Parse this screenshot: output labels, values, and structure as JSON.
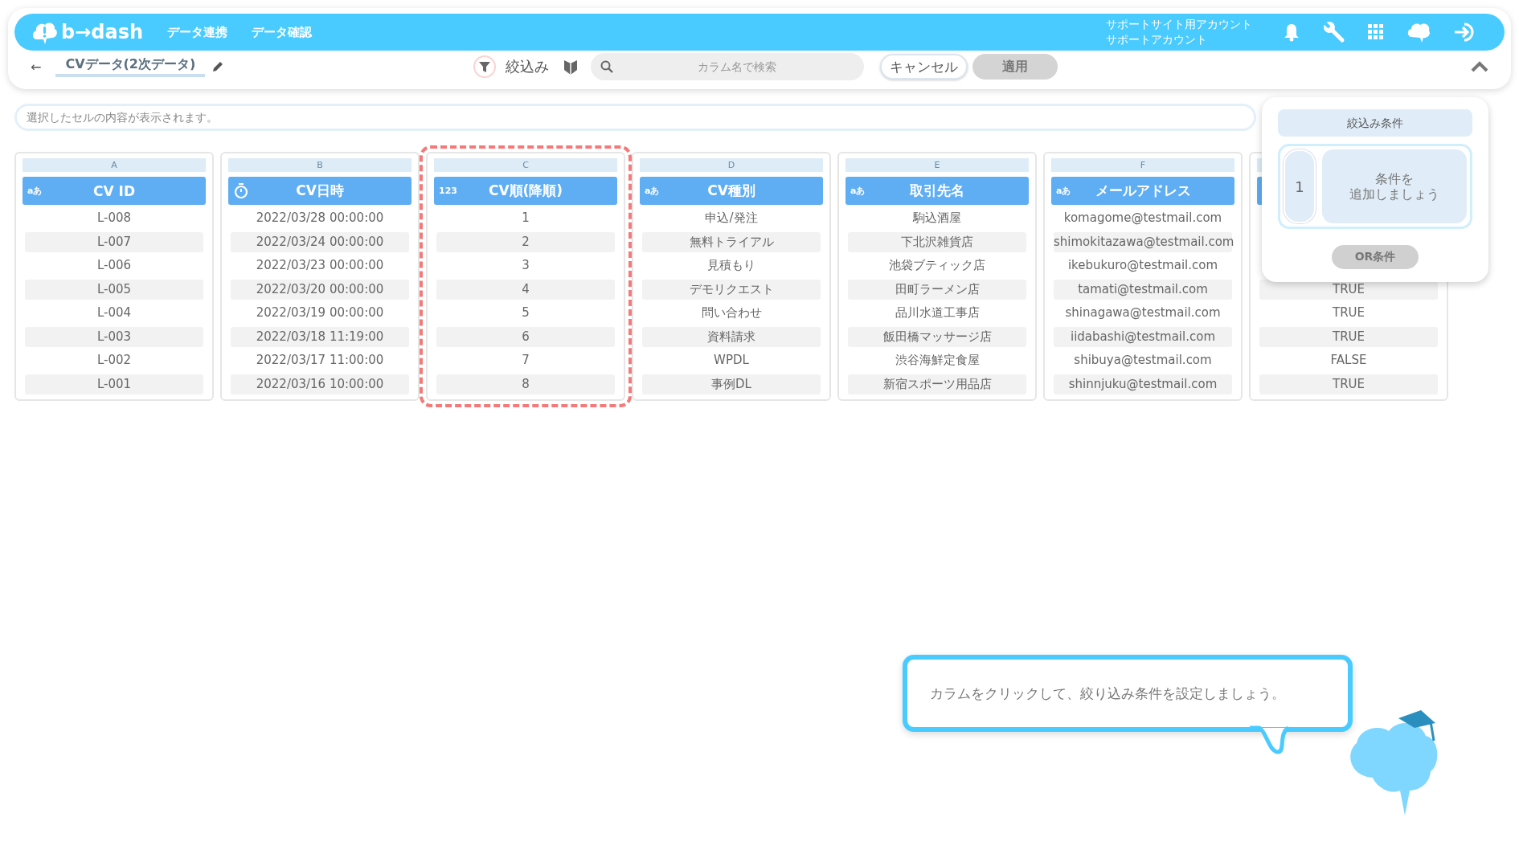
{
  "header": {
    "logo": "b→dash",
    "nav": [
      "データ連携",
      "データ確認"
    ],
    "account": [
      "サポートサイト用アカウント",
      "サポートアカウント"
    ]
  },
  "toolbar": {
    "back": "←",
    "title": "CVデータ(2次データ)",
    "filter_label": "絞込み",
    "search": {
      "placeholder": "カラム名で検索"
    },
    "cancel": "キャンセル",
    "apply": {
      "label": "適用",
      "disabled": true
    }
  },
  "cell_viewer": {
    "placeholder": "選択したセルの内容が表示されます。"
  },
  "table": {
    "columns": [
      {
        "letter": "A",
        "title": "CV ID",
        "kind": "text",
        "type_label": "aあ",
        "selected": false,
        "cells": [
          "L-008",
          "L-007",
          "L-006",
          "L-005",
          "L-004",
          "L-003",
          "L-002",
          "L-001"
        ]
      },
      {
        "letter": "B",
        "title": "CV日時",
        "kind": "datetime",
        "selected": false,
        "cells": [
          "2022/03/28 00:00:00",
          "2022/03/24 00:00:00",
          "2022/03/23 00:00:00",
          "2022/03/20 00:00:00",
          "2022/03/19 00:00:00",
          "2022/03/18 11:19:00",
          "2022/03/17 11:00:00",
          "2022/03/16 10:00:00"
        ]
      },
      {
        "letter": "C",
        "title": "CV順(降順)",
        "kind": "number",
        "type_label": "123",
        "selected": true,
        "cells": [
          "1",
          "2",
          "3",
          "4",
          "5",
          "6",
          "7",
          "8"
        ]
      },
      {
        "letter": "D",
        "title": "CV種別",
        "kind": "text",
        "type_label": "aあ",
        "selected": false,
        "cells": [
          "申込/発注",
          "無料トライアル",
          "見積もり",
          "デモリクエスト",
          "問い合わせ",
          "資料請求",
          "WPDL",
          "事例DL"
        ]
      },
      {
        "letter": "E",
        "title": "取引先名",
        "kind": "text",
        "type_label": "aあ",
        "selected": false,
        "cells": [
          "駒込酒屋",
          "下北沢雑貨店",
          "池袋ブティック店",
          "田町ラーメン店",
          "品川水道工事店",
          "飯田橋マッサージ店",
          "渋谷海鮮定食屋",
          "新宿スポーツ用品店"
        ]
      },
      {
        "letter": "F",
        "title": "メールアドレス",
        "kind": "text",
        "type_label": "aあ",
        "selected": false,
        "cells": [
          "komagome@testmail.com",
          "shimokitazawa@testmail.com",
          "ikebukuro@testmail.com",
          "tamati@testmail.com",
          "shinagawa@testmail.com",
          "iidabashi@testmail.com",
          "shibuya@testmail.com",
          "shinnjuku@testmail.com"
        ]
      },
      {
        "selected": false,
        "cells": [
          "TRUE",
          "TRUE",
          "TRUE",
          "FALSE",
          "TRUE"
        ]
      }
    ]
  },
  "filter_panel": {
    "title": "絞込み条件",
    "conditions": [
      {
        "number": "1",
        "lines": [
          "条件を",
          "追加しましょう"
        ]
      }
    ],
    "or_button": {
      "label": "OR条件",
      "disabled": true
    }
  },
  "tip": {
    "text": "カラムをクリックして、絞り込み条件を設定しましょう。"
  }
}
